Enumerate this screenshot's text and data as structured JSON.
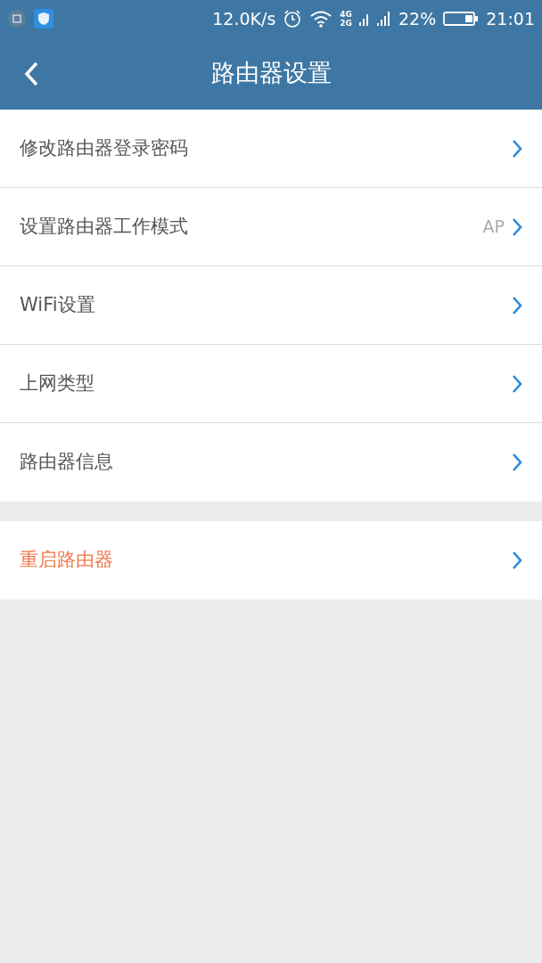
{
  "status_bar": {
    "network_speed": "12.0K/s",
    "network_labels": [
      "4G",
      "2G"
    ],
    "battery": "22%",
    "time": "21:01"
  },
  "header": {
    "title": "路由器设置"
  },
  "sections": [
    {
      "items": [
        {
          "label": "修改路由器登录密码",
          "kind": "normal"
        },
        {
          "label": "设置路由器工作模式",
          "value": "AP",
          "kind": "normal"
        },
        {
          "label": "WiFi设置",
          "kind": "normal"
        },
        {
          "label": "上网类型",
          "kind": "normal"
        },
        {
          "label": "路由器信息",
          "kind": "normal"
        }
      ]
    },
    {
      "items": [
        {
          "label": "重启路由器",
          "kind": "danger"
        }
      ]
    }
  ]
}
